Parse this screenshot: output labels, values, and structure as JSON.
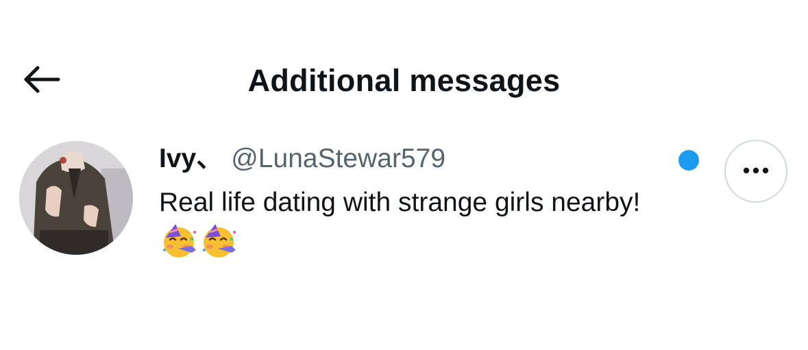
{
  "header": {
    "back_icon": "arrow-left-icon",
    "title": "Additional messages"
  },
  "message_item": {
    "avatar_icon": "user-avatar-photo",
    "display_name": "Ivy、",
    "handle": "@LunaStewar579",
    "text": "Real life dating with strange girls nearby!",
    "emojis": [
      "partying-face-emoji",
      "partying-face-emoji"
    ],
    "unread": true,
    "unread_color": "#1d9bf0",
    "more_icon": "more-horizontal-icon"
  },
  "colors": {
    "text_primary": "#0f1419",
    "text_secondary": "#536471",
    "accent": "#1d9bf0",
    "border": "#cfd9de"
  }
}
